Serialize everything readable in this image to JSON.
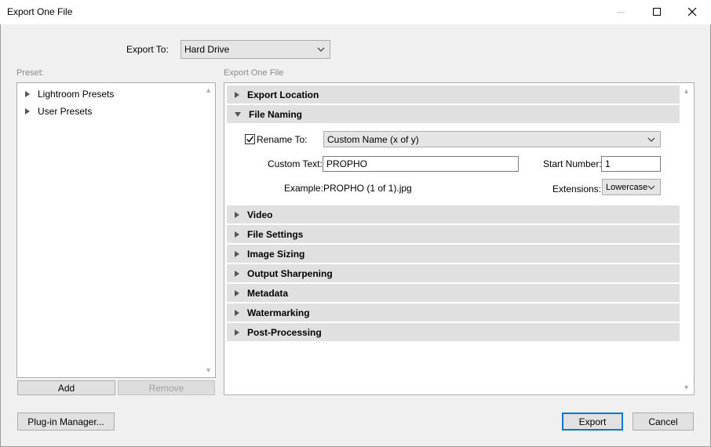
{
  "window": {
    "title": "Export One File",
    "minimize_glyph": "—",
    "maximize_glyph": "☐",
    "close_glyph": "✕"
  },
  "export_to": {
    "label": "Export To:",
    "value": "Hard Drive"
  },
  "preset": {
    "label": "Preset:",
    "items": [
      {
        "label": "Lightroom Presets"
      },
      {
        "label": "User Presets"
      }
    ],
    "add_label": "Add",
    "remove_label": "Remove"
  },
  "main": {
    "label": "Export One File",
    "sections": [
      {
        "label": "Export Location"
      },
      {
        "label": "File Naming"
      },
      {
        "label": "Video"
      },
      {
        "label": "File Settings"
      },
      {
        "label": "Image Sizing"
      },
      {
        "label": "Output Sharpening"
      },
      {
        "label": "Metadata"
      },
      {
        "label": "Watermarking"
      },
      {
        "label": "Post-Processing"
      }
    ]
  },
  "file_naming": {
    "rename_label": "Rename To:",
    "rename_checked": true,
    "rename_value": "Custom Name (x of y)",
    "custom_text_label": "Custom Text:",
    "custom_text_value": "PROPHO",
    "start_number_label": "Start Number:",
    "start_number_value": "1",
    "example_label": "Example:",
    "example_value": "PROPHO (1 of 1).jpg",
    "extensions_label": "Extensions:",
    "extensions_value": "Lowercase"
  },
  "footer": {
    "plugin_manager_label": "Plug-in Manager...",
    "export_label": "Export",
    "cancel_label": "Cancel"
  },
  "colors": {
    "accent": "#0078d7",
    "section_header": "#e0e0e0",
    "dialog_bg": "#f0f0f0"
  }
}
